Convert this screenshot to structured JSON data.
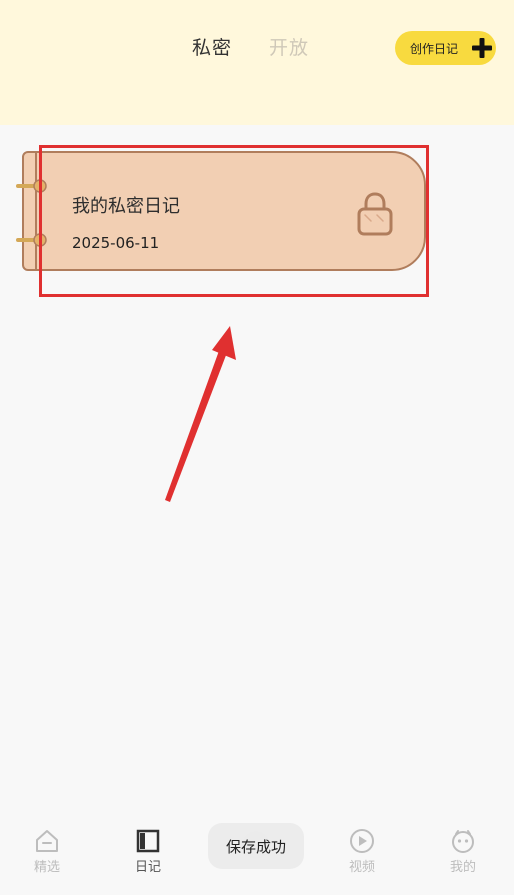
{
  "header": {
    "tabs": [
      {
        "label": "私密",
        "active": true
      },
      {
        "label": "开放",
        "active": false
      }
    ],
    "create_button": {
      "label": "创作日记",
      "icon": "plus-icon"
    },
    "background_color": "#fff8dc",
    "accent_color": "#f8da3f"
  },
  "diary_list": [
    {
      "title": "我的私密日记",
      "date": "2025-06-11",
      "icon": "lock-icon",
      "card_color": "#f2cfb3",
      "border_color": "#b07d5c"
    }
  ],
  "annotation": {
    "color": "#e03030",
    "shapes": [
      "highlight-box",
      "arrow"
    ]
  },
  "bottom_nav": [
    {
      "label": "精选",
      "icon": "home-icon",
      "active": false
    },
    {
      "label": "日记",
      "icon": "diary-icon",
      "active": true
    },
    {
      "label": "",
      "icon": "center-icon",
      "active": false
    },
    {
      "label": "视频",
      "icon": "play-icon",
      "active": false
    },
    {
      "label": "我的",
      "icon": "profile-icon",
      "active": false
    }
  ],
  "toast": {
    "text": "保存成功"
  }
}
